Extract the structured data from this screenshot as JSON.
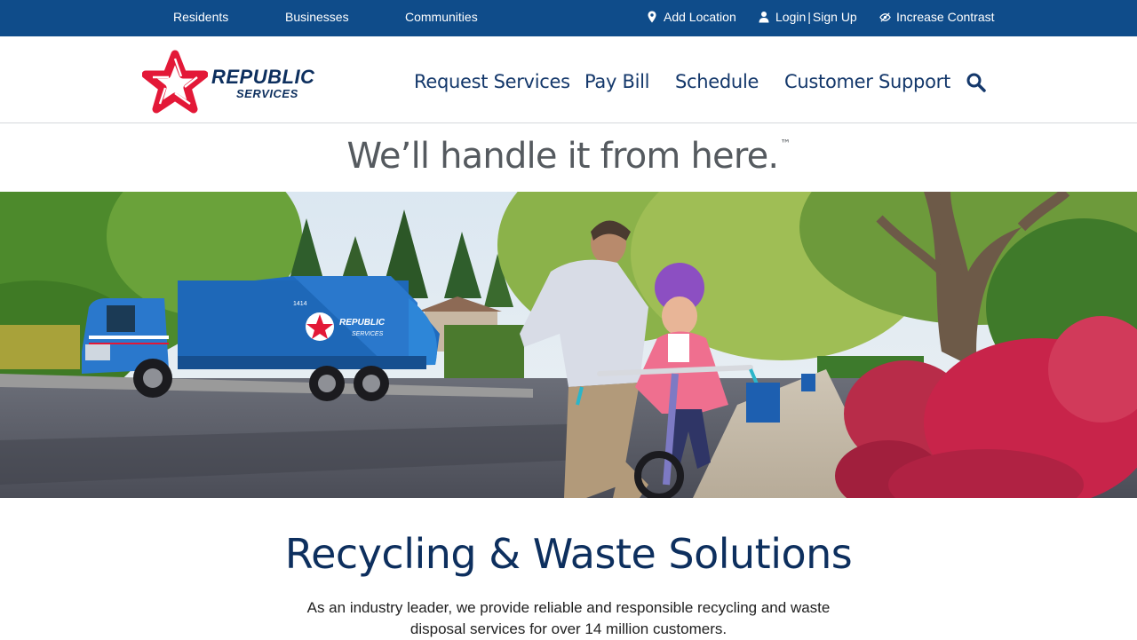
{
  "topbar": {
    "residents": "Residents",
    "businesses": "Businesses",
    "communities": "Communities",
    "add_location": "Add Location",
    "login": "Login",
    "sep": "|",
    "signup": "Sign Up",
    "contrast": "Increase Contrast"
  },
  "logo": {
    "line1": "REPUBLIC",
    "line2": "SERVICES"
  },
  "nav": {
    "request_services": "Request Services",
    "pay_bill": "Pay Bill",
    "schedule": "Schedule",
    "customer_support": "Customer Support"
  },
  "tagline": {
    "text": "We’ll handle it from here.",
    "tm": "™"
  },
  "hero": {
    "truck_number": "1414",
    "truck_brand_line1": "REPUBLIC",
    "truck_brand_line2": "SERVICES"
  },
  "solutions": {
    "title": "Recycling & Waste Solutions",
    "body": "As an industry leader, we provide reliable and responsible recycling and waste disposal services for over 14 million customers."
  },
  "colors": {
    "brand_navy": "#0f4c8a",
    "brand_dark": "#0d2f5e",
    "brand_red": "#e31837"
  }
}
